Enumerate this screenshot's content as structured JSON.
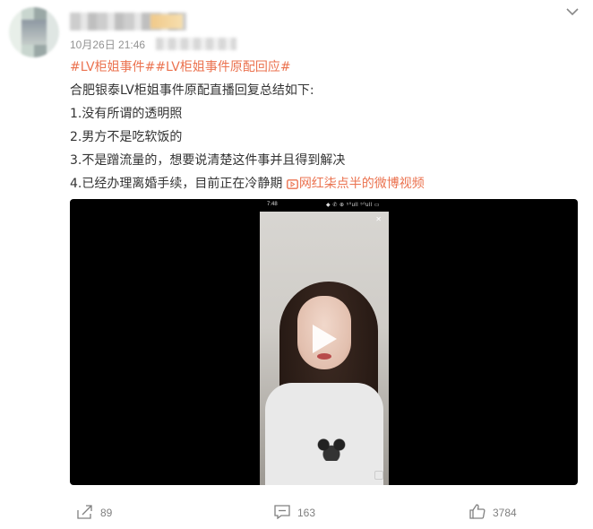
{
  "post": {
    "timestamp": "10月26日 21:46",
    "hashtag_1": "#LV柜姐事件#",
    "hashtag_2": "#LV柜姐事件原配回应#",
    "intro": "合肥银泰LV柜姐事件原配直播回复总结如下:",
    "points": [
      "1.没有所谓的透明照",
      "2.男方不是吃软饭的",
      "3.不是蹭流量的，想要说清楚这件事并且得到解决",
      "4.已经办理离婚手续，目前正在冷静期"
    ],
    "video_link_label": "网红柒点半的微博视频"
  },
  "video": {
    "phone_time": "7:48",
    "phone_status": "◆ ✆ ⊕ ⁵⁰ull ⁵⁰ull ▭"
  },
  "actions": {
    "repost_count": "89",
    "comment_count": "163",
    "like_count": "3784"
  },
  "icons": {
    "menu": "chevron-down-icon",
    "video_link": "video-link-icon",
    "play": "play-icon",
    "repost": "share-icon",
    "comment": "comment-icon",
    "like": "thumbs-up-icon"
  },
  "colors": {
    "accent": "#eb7350",
    "text": "#333333",
    "meta": "#939393",
    "video_bg": "#000000"
  }
}
